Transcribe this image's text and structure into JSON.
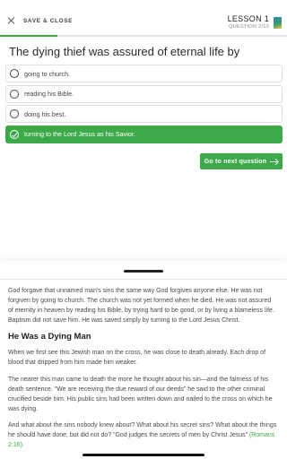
{
  "header": {
    "save_label": "SAVE & CLOSE",
    "lesson_title": "LESSON 1",
    "question_counter": "QUESTION 2/10"
  },
  "progress": {
    "fraction": 0.2,
    "fill_color": "#3daa49"
  },
  "quiz": {
    "question": "The dying thief was assured of eternal life by",
    "options": [
      {
        "label": "going to church.",
        "selected": false
      },
      {
        "label": "reading his Bible.",
        "selected": false
      },
      {
        "label": "doing his best.",
        "selected": false
      },
      {
        "label": "turning to the Lord Jesus as his Savior.",
        "selected": true
      }
    ],
    "next_label": "Go to next question"
  },
  "colors": {
    "accent": "#3daa49"
  },
  "sheet": {
    "para1": "God forgave that unnamed man's sins the same way God forgives anyone else. He was not forgiven by going to church. The church was not yet formed when he died. He was not assured of eternity in heaven by reading his Bible, by trying hard to be good, or by living a blameless life. Baptism did not save him. He was saved simply by turning to the Lord Jesus Christ.",
    "heading": "He Was a Dying Man",
    "para2": "When we first see this Jewish man on the cross, he was close to death already. Each drop of blood that dripped from him made him weaker.",
    "para3": "The nearer this man came to death the more he thought about his sin—and the fairness of his death sentence. “We are receiving the due reward of our deeds” he said to the other criminal crucified beside him. His public sins had been written down and nailed to the cross on which he was dying.",
    "para4": "And what about the sins nobody knew about? What about his secret sins? What about the things he should have done, but did not do? “God judges the secrets of men by Christ Jesus”",
    "para4_ref": "(Romans 2:16)."
  }
}
